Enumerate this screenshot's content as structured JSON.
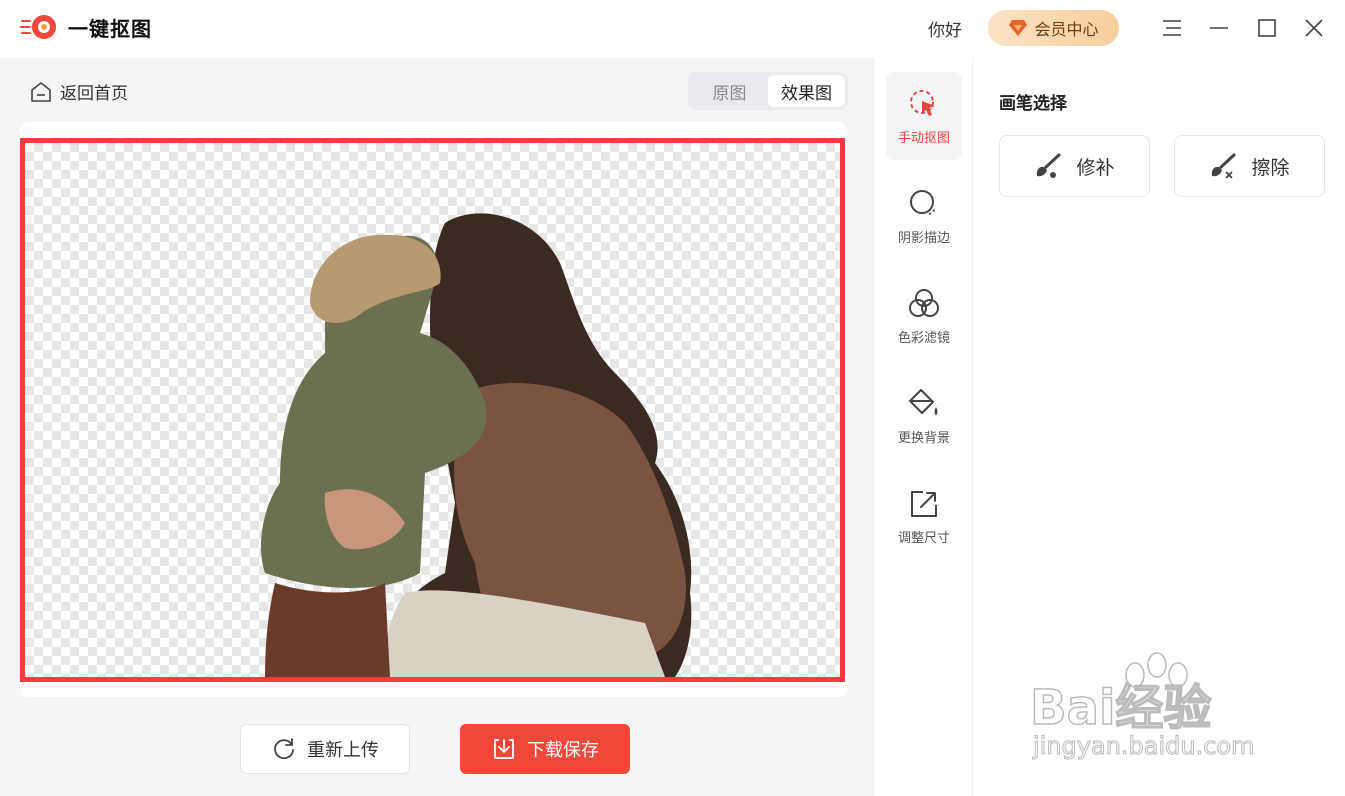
{
  "app": {
    "title": "一键抠图"
  },
  "header": {
    "greeting": "你好",
    "vip_label": "会员中心"
  },
  "nav": {
    "back_label": "返回首页"
  },
  "view_toggle": {
    "original": "原图",
    "result": "效果图",
    "selected": "效果图"
  },
  "zoom_toolbar": [
    "hand-icon",
    "zoom-out-icon",
    "zoom-in-icon",
    "actual-size-icon"
  ],
  "actions": {
    "reupload": "重新上传",
    "download": "下载保存"
  },
  "tools": [
    {
      "label": "手动抠图",
      "icon": "manual-cutout-icon",
      "active": true
    },
    {
      "label": "阴影描边",
      "icon": "shadow-stroke-icon",
      "active": false
    },
    {
      "label": "色彩滤镜",
      "icon": "color-filter-icon",
      "active": false
    },
    {
      "label": "更换背景",
      "icon": "paint-bucket-icon",
      "active": false
    },
    {
      "label": "调整尺寸",
      "icon": "resize-icon",
      "active": false
    }
  ],
  "brush_panel": {
    "title": "画笔选择",
    "repair": "修补",
    "erase": "擦除"
  },
  "watermark": {
    "brand": "Bai经验",
    "url": "jingyan.baidu.com"
  },
  "colors": {
    "accent": "#f0483a",
    "canvas_border": "#f03d3d",
    "vip_bg": "#f6cd9c"
  }
}
